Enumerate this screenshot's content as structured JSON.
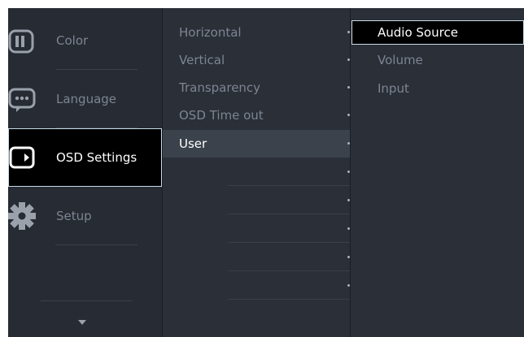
{
  "main_menu": {
    "items": [
      {
        "label": "Color",
        "icon": "color-icon"
      },
      {
        "label": "Language",
        "icon": "language-icon"
      },
      {
        "label": "OSD Settings",
        "icon": "osd-settings-icon",
        "selected": true
      },
      {
        "label": "Setup",
        "icon": "setup-icon"
      }
    ]
  },
  "sub_menu": {
    "items": [
      {
        "label": "Horizontal"
      },
      {
        "label": "Vertical"
      },
      {
        "label": "Transparency"
      },
      {
        "label": "OSD Time out"
      },
      {
        "label": "User",
        "selected": true
      },
      {
        "label": ""
      },
      {
        "label": ""
      },
      {
        "label": ""
      },
      {
        "label": ""
      },
      {
        "label": ""
      }
    ]
  },
  "options": {
    "items": [
      {
        "label": "Audio Source",
        "selected": true
      },
      {
        "label": "Volume"
      },
      {
        "label": "Input"
      }
    ]
  },
  "colors": {
    "background": "#252a33",
    "selected_border": "#c9dce8",
    "selected_fill": "#000000",
    "active_row": "#3c424c",
    "text_dim": "#7d8591",
    "text_active": "#ffffff"
  }
}
